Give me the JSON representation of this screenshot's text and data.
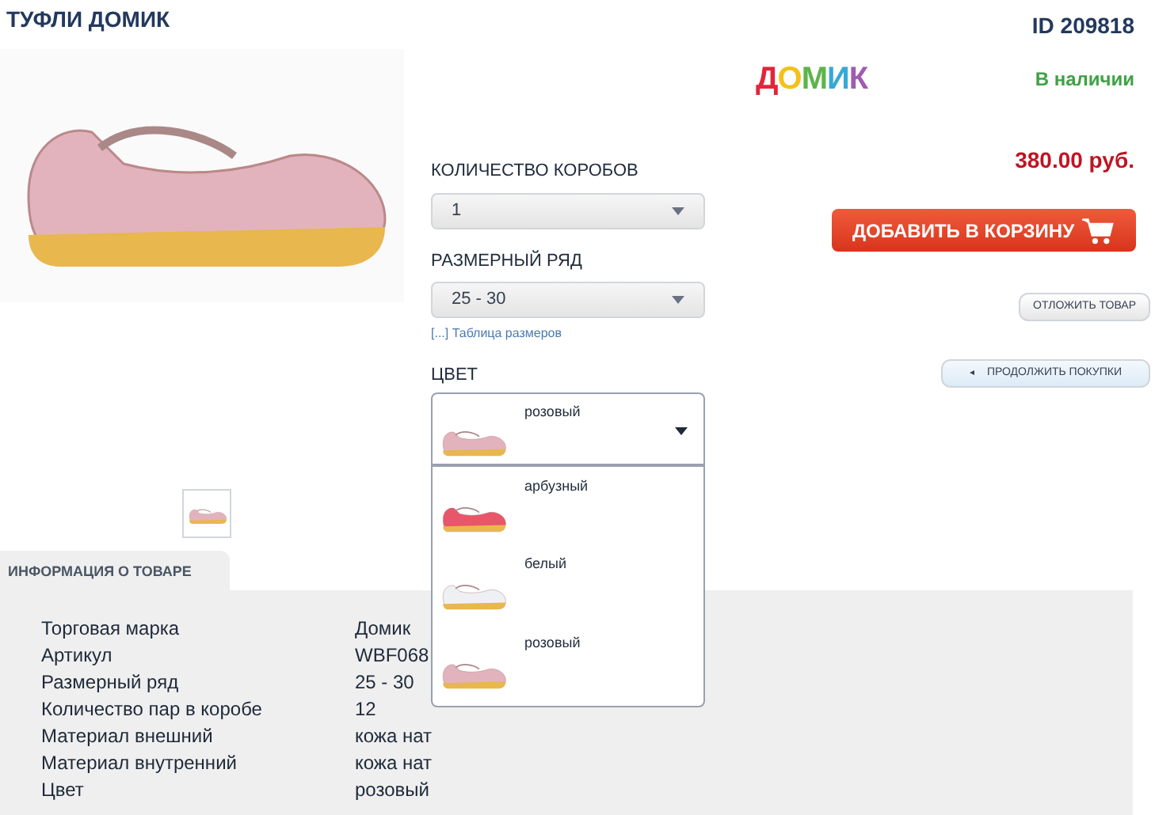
{
  "product": {
    "title": "ТУФЛИ ДОМИК",
    "id": "ID 209818",
    "brand_logo": "ДОМИК",
    "availability": "В наличии",
    "price": "380.00 руб."
  },
  "quantity": {
    "label": "КОЛИЧЕСТВО КОРОБОВ",
    "value": "1"
  },
  "size": {
    "label": "РАЗМЕРНЫЙ РЯД",
    "value": "25 - 30",
    "link": "[...] Таблица размеров"
  },
  "color_select": {
    "label": "ЦВЕТ",
    "value": "розовый",
    "color": "#e2b3bd",
    "expanded": true,
    "choices": [
      {
        "label": "арбузный",
        "color": "#e8566a"
      },
      {
        "label": "белый",
        "color": "#eef0f4"
      },
      {
        "label": "розовый",
        "color": "#e2b3bd"
      }
    ]
  },
  "buttons": {
    "add_to_cart": "ДОБАВИТЬ В КОРЗИНУ",
    "postpone": "ОТЛОЖИТЬ ТОВАР",
    "continue": "ПРОДОЛЖИТЬ ПОКУПКИ",
    "continue_icon": "◂"
  },
  "info": {
    "tab": "ИНФОРМАЦИЯ О ТОВАРЕ",
    "rows": [
      {
        "label": "Торговая марка",
        "value": "Домик"
      },
      {
        "label": "Артикул",
        "value": "WBF068"
      },
      {
        "label": "Размерный ряд",
        "value": "25 - 30"
      },
      {
        "label": "Количество пар в коробе",
        "value": "12"
      },
      {
        "label": "Материал внешний",
        "value": "кожа нат"
      },
      {
        "label": "Материал внутренний",
        "value": "кожа нат"
      },
      {
        "label": "Цвет",
        "value": "розовый"
      }
    ]
  }
}
